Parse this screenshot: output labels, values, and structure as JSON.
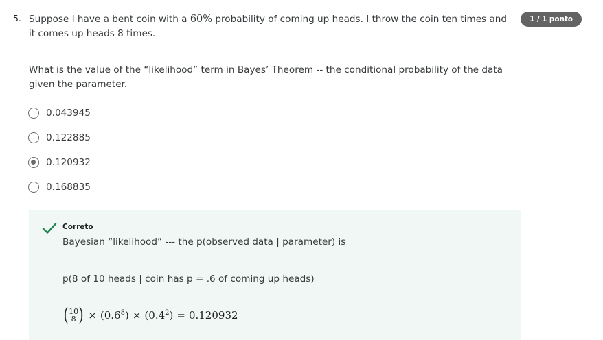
{
  "question": {
    "number": "5.",
    "text_before": "Suppose I have a bent coin with a ",
    "math_percent": "60%",
    "text_after": " probability of coming up heads. I throw the coin ten times and it comes up heads 8 times.",
    "prompt": "What is the value of the “likelihood” term in Bayes’ Theorem -- the conditional probability of the data given the parameter."
  },
  "score_badge": "1 / 1 ponto",
  "options": [
    {
      "label": "0.043945",
      "selected": false
    },
    {
      "label": "0.122885",
      "selected": false
    },
    {
      "label": "0.120932",
      "selected": true
    },
    {
      "label": "0.168835",
      "selected": false
    }
  ],
  "feedback": {
    "status": "Correto",
    "icon": "checkmark-icon",
    "line1": "Bayesian “likelihood” --- the p(observed data | parameter) is",
    "line2": "p(8 of 10 heads | coin has p = .6 of coming up heads)",
    "formula": {
      "binom_n": "10",
      "binom_k": "8",
      "times1": "×",
      "term1_base": "(0.6",
      "term1_exp": "8",
      "term1_close": ")",
      "times2": "×",
      "term2_base": "(0.4",
      "term2_exp": "2",
      "term2_close": ")",
      "equals": "=",
      "result": "0.120932"
    }
  },
  "colors": {
    "badge_bg": "#636363",
    "feedback_bg": "#f1f7f4",
    "check_green": "#1f8354"
  }
}
